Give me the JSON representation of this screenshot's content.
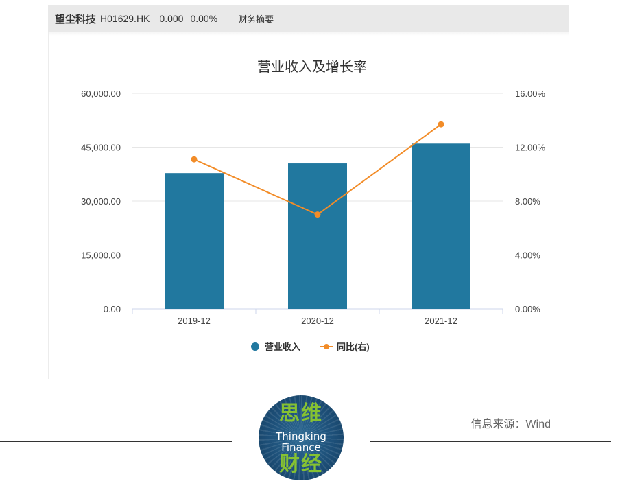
{
  "header": {
    "company": "望尘科技",
    "code": "H01629.HK",
    "price": "0.000",
    "change": "0.00%",
    "section": "财务摘要"
  },
  "chart_data": {
    "type": "bar",
    "title": "营业收入及增长率",
    "categories": [
      "2019-12",
      "2020-12",
      "2021-12"
    ],
    "series": [
      {
        "name": "营业收入",
        "kind": "bar",
        "axis": "left",
        "color": "#21789f",
        "values": [
          37800,
          40500,
          46000
        ]
      },
      {
        "name": "同比(右)",
        "kind": "line",
        "axis": "right",
        "color": "#f28c28",
        "values": [
          11.1,
          7.0,
          13.7
        ]
      }
    ],
    "y_left": {
      "min": 0,
      "max": 60000,
      "ticks": [
        "0.00",
        "15,000.00",
        "30,000.00",
        "45,000.00",
        "60,000.00"
      ]
    },
    "y_right": {
      "min": 0,
      "max": 16,
      "ticks": [
        "0.00%",
        "4.00%",
        "8.00%",
        "12.00%",
        "16.00%"
      ]
    },
    "grid": true,
    "legend": "bottom-center"
  },
  "footer": {
    "logo_cn_top": "思维",
    "logo_en_line1": "Thingking",
    "logo_en_line2": "Finance",
    "logo_cn_bottom": "财经",
    "source": "信息来源：Wind"
  }
}
